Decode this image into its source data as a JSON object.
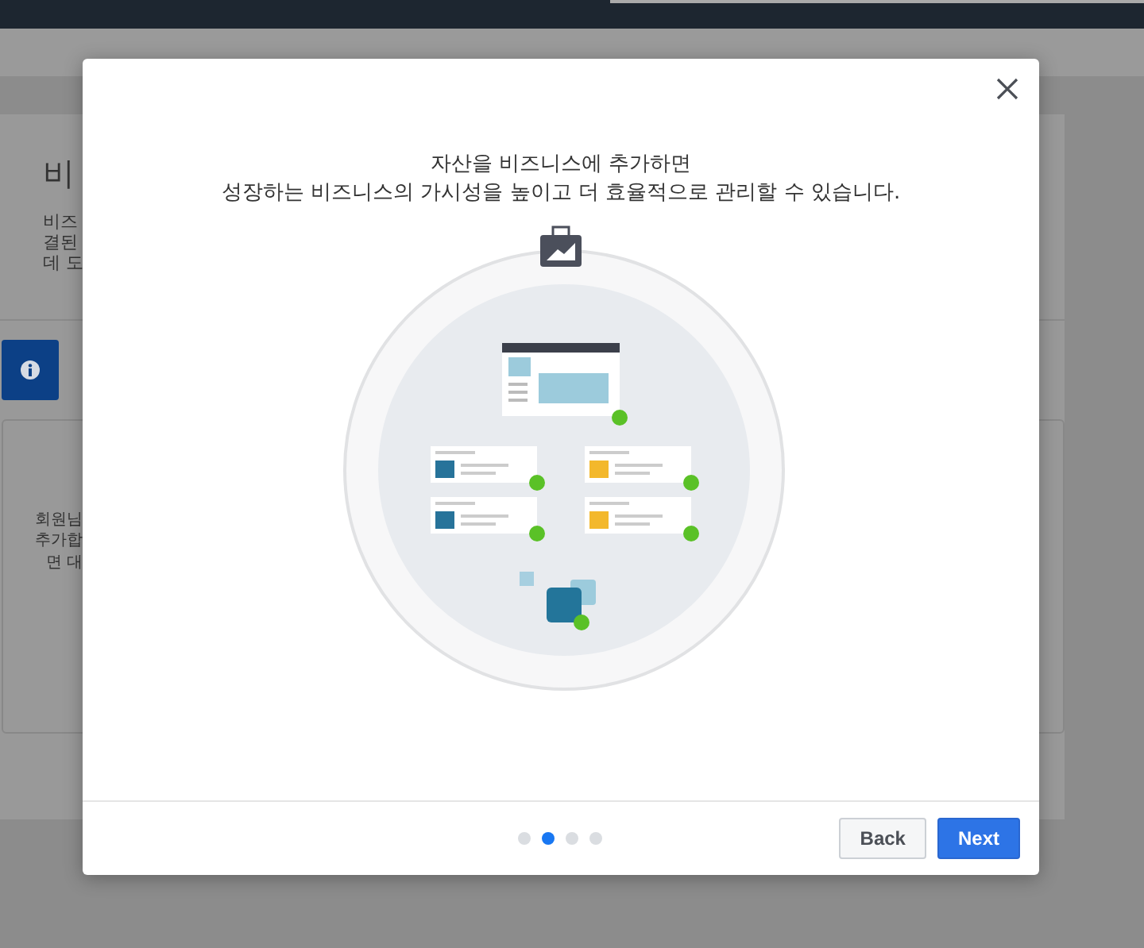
{
  "background": {
    "heading": "비",
    "description_lines": [
      "비즈",
      "결된",
      "데 도"
    ],
    "info_lines": [
      "회원님",
      "추가합",
      "면 대"
    ]
  },
  "dialog": {
    "title_lines": [
      "자산을 비즈니스에 추가하면",
      "성장하는 비즈니스의 가시성을 높이고 더 효율적으로 관리할 수 있습니다."
    ],
    "page_dots": [
      {
        "selected": false
      },
      {
        "selected": true
      },
      {
        "selected": false
      },
      {
        "selected": false
      }
    ],
    "buttons": [
      {
        "label": "Back",
        "kind": "secondary"
      },
      {
        "label": "Next",
        "kind": "primary"
      }
    ]
  }
}
